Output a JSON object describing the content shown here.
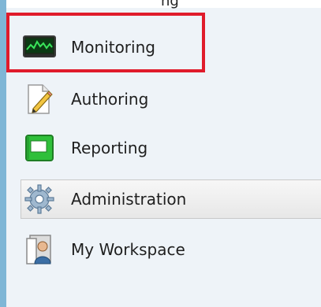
{
  "header": {
    "partial_text": "ng"
  },
  "nav": {
    "items": [
      {
        "label": "Monitoring",
        "icon": "monitoring-icon"
      },
      {
        "label": "Authoring",
        "icon": "authoring-icon"
      },
      {
        "label": "Reporting",
        "icon": "reporting-icon"
      },
      {
        "label": "Administration",
        "icon": "administration-icon"
      },
      {
        "label": "My Workspace",
        "icon": "my-workspace-icon"
      }
    ],
    "selected": "Administration",
    "highlighted": "Monitoring"
  },
  "colors": {
    "highlight_border": "#e01b2b",
    "left_edge": "#7fb6d6",
    "panel_background": "#eef3f8"
  }
}
